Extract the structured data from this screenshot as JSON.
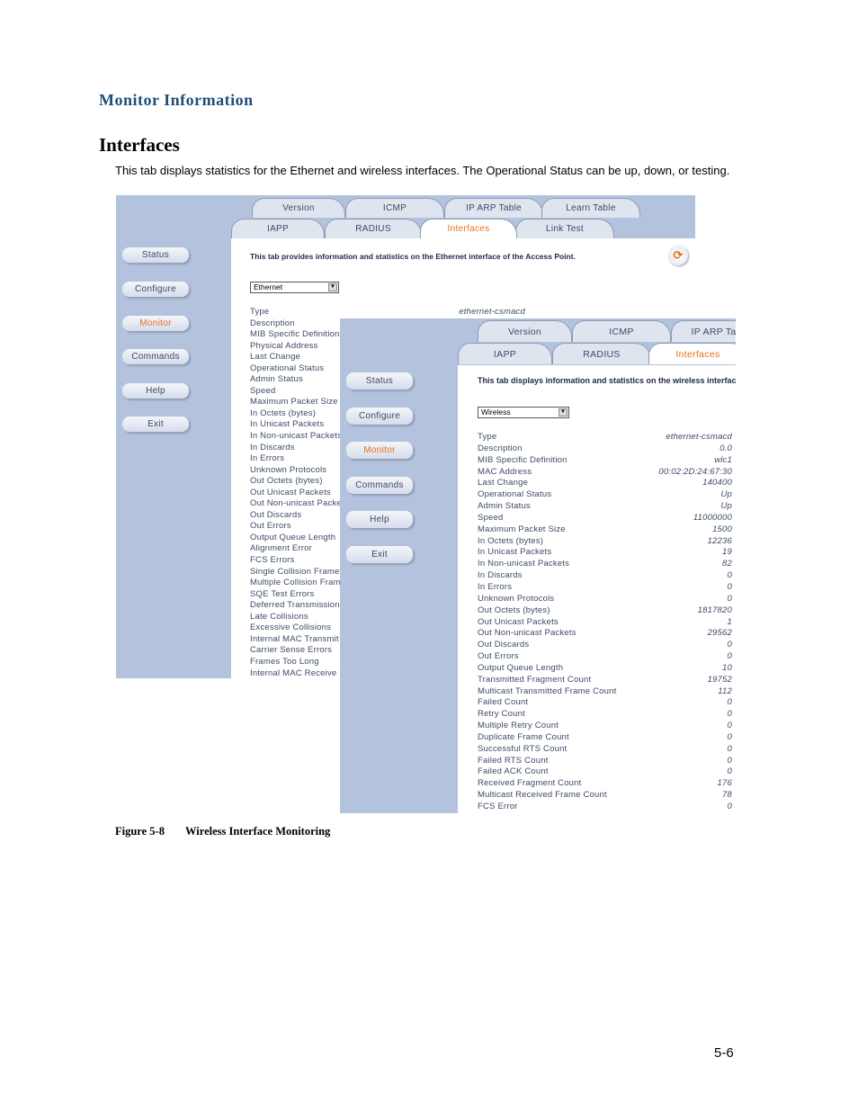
{
  "document": {
    "section_title": "Monitor Information",
    "heading": "Interfaces",
    "intro": "This tab displays statistics for the Ethernet and wireless interfaces. The Operational Status can be up, down, or testing.",
    "figure_number": "Figure 5-8",
    "figure_title": "Wireless Interface Monitoring",
    "page_number": "5-6"
  },
  "colors": {
    "section_title": "#1f4e79",
    "sidebar_bg": "#b4c3dd",
    "active_accent": "#e8701a",
    "text": "#3d4a66"
  },
  "ethernet_screen": {
    "tabs_row1": [
      "Version",
      "ICMP",
      "IP ARP Table",
      "Learn Table"
    ],
    "tabs_row2": [
      "IAPP",
      "RADIUS",
      "Interfaces",
      "Link Test"
    ],
    "active_tab": "Interfaces",
    "nav": [
      "Status",
      "Configure",
      "Monitor",
      "Commands",
      "Help",
      "Exit"
    ],
    "active_nav": "Monitor",
    "description": "This tab provides information and statistics on the Ethernet interface of the Access Point.",
    "refresh_icon": "refresh-icon",
    "interface_select": "Ethernet",
    "type_value": "ethernet-csmacd",
    "stats": [
      "Type",
      "Description",
      "MIB Specific Definition",
      "Physical Address",
      "Last Change",
      "Operational Status",
      "Admin Status",
      "Speed",
      "Maximum Packet Size",
      "In Octets (bytes)",
      "In Unicast Packets",
      "In Non-unicast Packets",
      "In Discards",
      "In Errors",
      "Unknown Protocols",
      "Out Octets (bytes)",
      "Out Unicast Packets",
      "Out Non-unicast Packets",
      "Out Discards",
      "Out Errors",
      "Output Queue Length",
      "Alignment Error",
      "FCS Errors",
      "Single Collision Frames",
      "Multiple Collision Frames",
      "SQE Test Errors",
      "Deferred Transmissions",
      "Late Collisions",
      "Excessive Collisions",
      "Internal MAC Transmit Errors",
      "Carrier Sense Errors",
      "Frames Too Long",
      "Internal MAC Receive Errors"
    ]
  },
  "wireless_screen": {
    "tabs_row1": [
      "Version",
      "ICMP",
      "IP ARP Table"
    ],
    "tabs_row2": [
      "IAPP",
      "RADIUS",
      "Interfaces"
    ],
    "active_tab": "Interfaces",
    "nav": [
      "Status",
      "Configure",
      "Monitor",
      "Commands",
      "Help",
      "Exit"
    ],
    "active_nav": "Monitor",
    "description": "This tab displays information and statistics on the wireless interface",
    "interface_select": "Wireless",
    "stats": [
      {
        "label": "Type",
        "value": "ethernet-csmacd"
      },
      {
        "label": "Description",
        "value": "0.0"
      },
      {
        "label": "MIB Specific Definition",
        "value": "wlc1"
      },
      {
        "label": "MAC Address",
        "value": "00:02:2D:24:67:30"
      },
      {
        "label": "Last Change",
        "value": "140400"
      },
      {
        "label": "Operational Status",
        "value": "Up"
      },
      {
        "label": "Admin Status",
        "value": "Up"
      },
      {
        "label": "Speed",
        "value": "11000000"
      },
      {
        "label": "Maximum Packet Size",
        "value": "1500"
      },
      {
        "label": "In Octets (bytes)",
        "value": "12236"
      },
      {
        "label": "In Unicast Packets",
        "value": "19"
      },
      {
        "label": "In Non-unicast Packets",
        "value": "82"
      },
      {
        "label": "In Discards",
        "value": "0"
      },
      {
        "label": "In Errors",
        "value": "0"
      },
      {
        "label": "Unknown Protocols",
        "value": "0"
      },
      {
        "label": "Out Octets (bytes)",
        "value": "1817820"
      },
      {
        "label": "Out Unicast Packets",
        "value": "1"
      },
      {
        "label": "Out Non-unicast Packets",
        "value": "29562"
      },
      {
        "label": "Out Discards",
        "value": "0"
      },
      {
        "label": "Out Errors",
        "value": "0"
      },
      {
        "label": "Output Queue Length",
        "value": "10"
      },
      {
        "label": "Transmitted Fragment Count",
        "value": "19752"
      },
      {
        "label": "Multicast Transmitted Frame Count",
        "value": "112"
      },
      {
        "label": "Failed Count",
        "value": "0"
      },
      {
        "label": "Retry Count",
        "value": "0"
      },
      {
        "label": "Multiple Retry Count",
        "value": "0"
      },
      {
        "label": "Duplicate Frame Count",
        "value": "0"
      },
      {
        "label": "Successful RTS Count",
        "value": "0"
      },
      {
        "label": "Failed RTS Count",
        "value": "0"
      },
      {
        "label": "Failed ACK Count",
        "value": "0"
      },
      {
        "label": "Received Fragment Count",
        "value": "176"
      },
      {
        "label": "Multicast Received Frame Count",
        "value": "78"
      },
      {
        "label": "FCS Error",
        "value": "0"
      }
    ]
  }
}
